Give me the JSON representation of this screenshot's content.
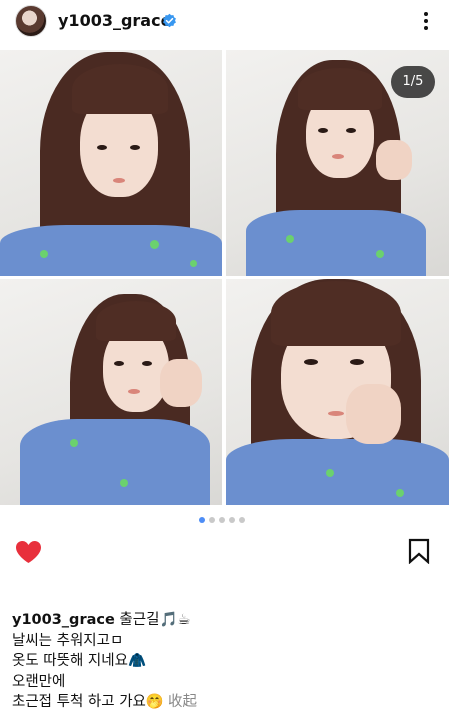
{
  "header": {
    "username": "y1003_grace",
    "verified": true,
    "avatar_icon": "profile-avatar",
    "more_icon": "more-vertical-icon"
  },
  "carousel": {
    "counter": "1/5",
    "total_pages": 5,
    "current_page": 1,
    "active_dot_color": "#4d8df6",
    "inactive_dot_color": "#c9c9c9"
  },
  "actions": {
    "like_icon": "heart-filled-icon",
    "liked": true,
    "like_color": "#e8303c",
    "save_icon": "bookmark-icon"
  },
  "caption": {
    "username": "y1003_grace",
    "lines": [
      "출근길🎵☕",
      "날씨는 추워지고ㅁ",
      "옷도 따뜻해 지네요🧥",
      "오랜만에",
      "초근접 투척 하고 가요🤭"
    ],
    "more_label": "收起"
  }
}
